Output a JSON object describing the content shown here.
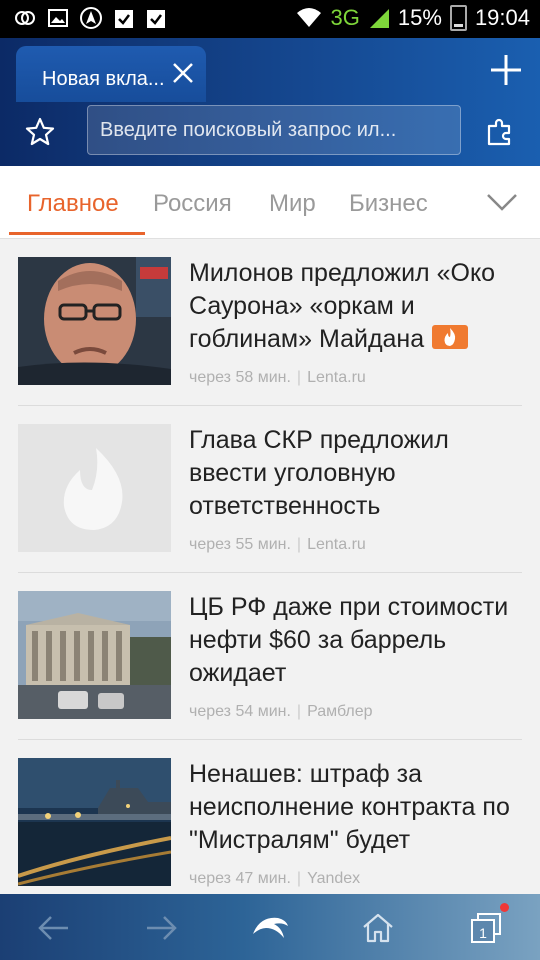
{
  "status_bar": {
    "network": "3G",
    "battery": "15%",
    "time": "19:04",
    "icons": [
      "app-icon",
      "image-icon",
      "navigation-icon",
      "clipboard-check-icon",
      "clipboard-check-icon",
      "wifi-icon",
      "signal-icon",
      "battery-icon"
    ]
  },
  "browser": {
    "tab_title": "Новая вкла...",
    "search_placeholder": "Введите поисковый запрос ил..."
  },
  "categories": {
    "items": [
      "Главное",
      "Россия",
      "Мир",
      "Бизнес"
    ],
    "active": "Главное"
  },
  "news": [
    {
      "title": "Милонов предложил «Око Саурона» «оркам и гоблинам» Майдана",
      "time": "через 58 мин.",
      "source": "Lenta.ru",
      "hot": true
    },
    {
      "title": "Глава СКР предложил ввести уголовную ответственность",
      "time": "через 55 мин.",
      "source": "Lenta.ru",
      "hot": false
    },
    {
      "title": "ЦБ РФ даже при стоимости нефти $60 за баррель ожидает",
      "time": "через 54 мин.",
      "source": "Рамблер",
      "hot": false
    },
    {
      "title": "Ненашев: штраф за неисполнение контракта по \"Мистралям\" будет",
      "time": "через 47 мин.",
      "source": "Yandex",
      "hot": false
    }
  ],
  "bottom_bar": {
    "tabs_count": "1"
  },
  "colors": {
    "accent": "#e8642c",
    "header": "#15478f",
    "hot_badge": "#f07a30"
  }
}
